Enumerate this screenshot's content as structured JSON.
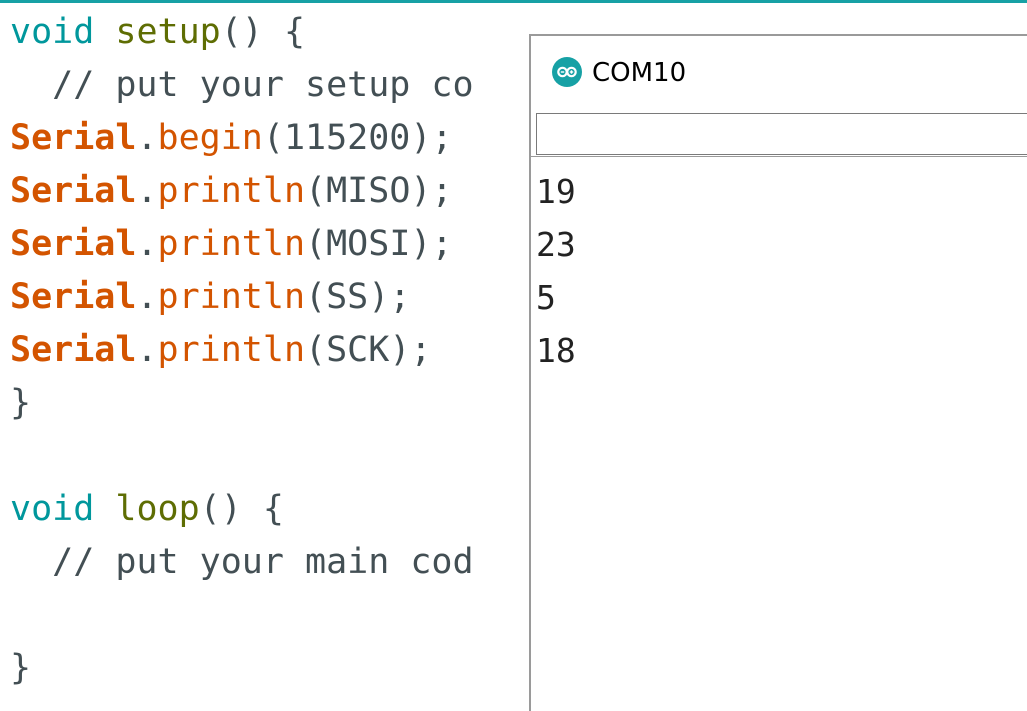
{
  "editor": {
    "lines": [
      {
        "tokens": [
          {
            "text": "void",
            "cls": "kw-type"
          },
          {
            "text": " ",
            "cls": "punct"
          },
          {
            "text": "setup",
            "cls": "kw-fn"
          },
          {
            "text": "() {",
            "cls": "punct"
          }
        ]
      },
      {
        "tokens": [
          {
            "text": "  // put your setup co",
            "cls": "comment"
          }
        ]
      },
      {
        "tokens": [
          {
            "text": "Serial",
            "cls": "kw-obj"
          },
          {
            "text": ".",
            "cls": "punct"
          },
          {
            "text": "begin",
            "cls": "kw-meth"
          },
          {
            "text": "(115200);",
            "cls": "punct"
          }
        ]
      },
      {
        "tokens": [
          {
            "text": "Serial",
            "cls": "kw-obj"
          },
          {
            "text": ".",
            "cls": "punct"
          },
          {
            "text": "println",
            "cls": "kw-meth"
          },
          {
            "text": "(MISO);",
            "cls": "punct"
          }
        ]
      },
      {
        "tokens": [
          {
            "text": "Serial",
            "cls": "kw-obj"
          },
          {
            "text": ".",
            "cls": "punct"
          },
          {
            "text": "println",
            "cls": "kw-meth"
          },
          {
            "text": "(MOSI);",
            "cls": "punct"
          }
        ]
      },
      {
        "tokens": [
          {
            "text": "Serial",
            "cls": "kw-obj"
          },
          {
            "text": ".",
            "cls": "punct"
          },
          {
            "text": "println",
            "cls": "kw-meth"
          },
          {
            "text": "(SS);",
            "cls": "punct"
          }
        ]
      },
      {
        "tokens": [
          {
            "text": "Serial",
            "cls": "kw-obj"
          },
          {
            "text": ".",
            "cls": "punct"
          },
          {
            "text": "println",
            "cls": "kw-meth"
          },
          {
            "text": "(SCK);",
            "cls": "punct"
          }
        ]
      },
      {
        "tokens": [
          {
            "text": "}",
            "cls": "punct"
          }
        ]
      },
      {
        "tokens": []
      },
      {
        "tokens": [
          {
            "text": "void",
            "cls": "kw-type"
          },
          {
            "text": " ",
            "cls": "punct"
          },
          {
            "text": "loop",
            "cls": "kw-fn"
          },
          {
            "text": "() {",
            "cls": "punct"
          }
        ]
      },
      {
        "tokens": [
          {
            "text": "  // put your main cod",
            "cls": "comment"
          }
        ]
      },
      {
        "tokens": []
      },
      {
        "tokens": [
          {
            "text": "}",
            "cls": "punct"
          }
        ]
      }
    ]
  },
  "serial_monitor": {
    "title": "COM10",
    "icon": "arduino-infinity-icon",
    "input_value": "",
    "output": [
      "19",
      "23",
      "5",
      "18"
    ]
  },
  "colors": {
    "accent": "#17a1a5",
    "keyword_type": "#00979c",
    "function_name": "#5e6d03",
    "serial_object": "#d35400"
  }
}
